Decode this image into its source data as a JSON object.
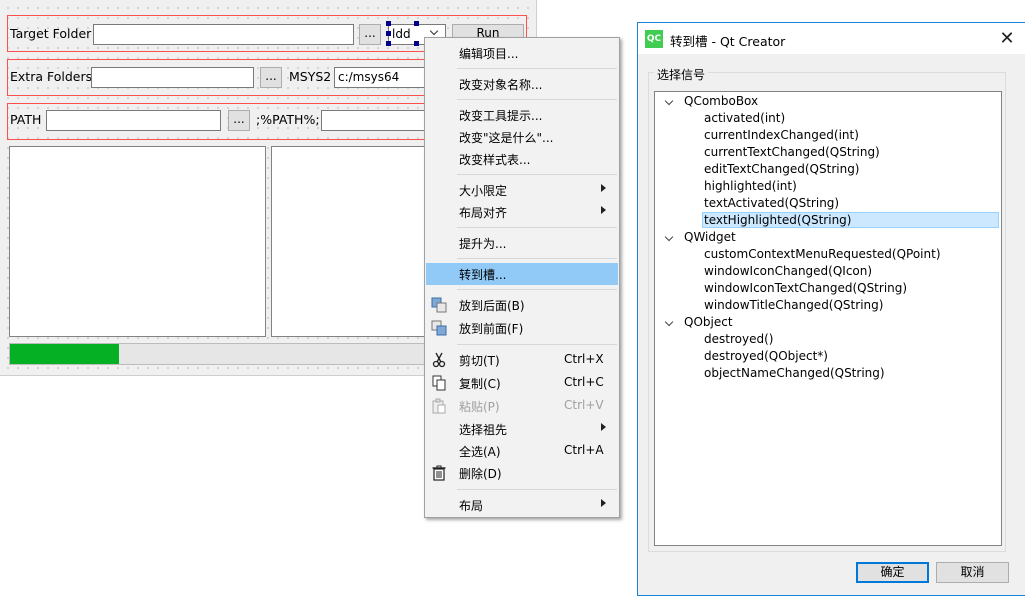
{
  "form": {
    "target_label": "Target Folder",
    "browse_label": "...",
    "combo_value": "ldd",
    "run_label": "Run",
    "extra_label": "Extra Folders",
    "msys2_label": "MSYS2",
    "msys2_value": "c:/msys64",
    "path_label": "PATH",
    "path_suffix": ";%PATH%;",
    "progress_value": 0.21
  },
  "context_menu": {
    "items": [
      {
        "label": "编辑项目..."
      },
      {
        "label": "改变对象名称..."
      },
      {
        "label": "改变工具提示..."
      },
      {
        "label": "改变\"这是什么\"..."
      },
      {
        "label": "改变样式表..."
      },
      {
        "label": "大小限定"
      },
      {
        "label": "布局对齐"
      },
      {
        "label": "提升为..."
      },
      {
        "label": "转到槽..."
      },
      {
        "label": "放到后面(B)"
      },
      {
        "label": "放到前面(F)"
      },
      {
        "label": "剪切(T)",
        "shortcut": "Ctrl+X"
      },
      {
        "label": "复制(C)",
        "shortcut": "Ctrl+C"
      },
      {
        "label": "粘贴(P)",
        "shortcut": "Ctrl+V"
      },
      {
        "label": "选择祖先"
      },
      {
        "label": "全选(A)",
        "shortcut": "Ctrl+A"
      },
      {
        "label": "删除(D)"
      },
      {
        "label": "布局"
      }
    ]
  },
  "dialog": {
    "app_icon_text": "QC",
    "title": "转到槽 - Qt Creator",
    "close_glyph": "✕",
    "group_title": "选择信号",
    "tree": [
      {
        "label": "QComboBox",
        "children": [
          "activated(int)",
          "currentIndexChanged(int)",
          "currentTextChanged(QString)",
          "editTextChanged(QString)",
          "highlighted(int)",
          "textActivated(QString)",
          "textHighlighted(QString)"
        ]
      },
      {
        "label": "QWidget",
        "children": [
          "customContextMenuRequested(QPoint)",
          "windowIconChanged(QIcon)",
          "windowIconTextChanged(QString)",
          "windowTitleChanged(QString)"
        ]
      },
      {
        "label": "QObject",
        "children": [
          "destroyed()",
          "destroyed(QObject*)",
          "objectNameChanged(QString)"
        ]
      }
    ],
    "selected": "textHighlighted(QString)",
    "ok_label": "确定",
    "cancel_label": "取消"
  },
  "colors": {
    "selection": "#91c9f7",
    "tree_selection": "#cce8ff",
    "progress": "#06b025",
    "layout_outline": "#ff4f4f",
    "dialog_border": "#1883d7"
  }
}
